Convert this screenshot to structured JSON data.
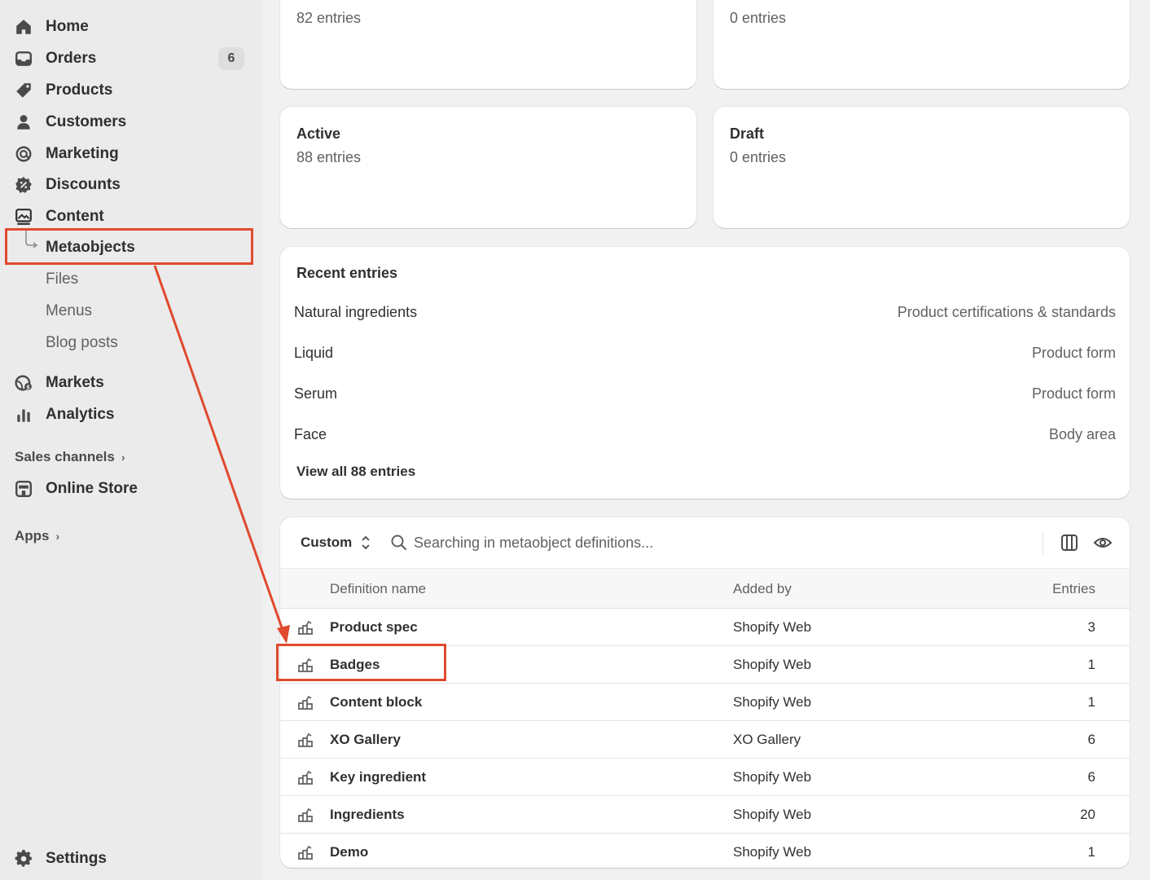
{
  "sidebar": {
    "items": [
      {
        "label": "Home",
        "icon": "home-icon"
      },
      {
        "label": "Orders",
        "icon": "inbox-icon",
        "badge": "6"
      },
      {
        "label": "Products",
        "icon": "tag-icon"
      },
      {
        "label": "Customers",
        "icon": "person-icon"
      },
      {
        "label": "Marketing",
        "icon": "target-icon"
      },
      {
        "label": "Discounts",
        "icon": "discount-icon"
      },
      {
        "label": "Content",
        "icon": "image-icon"
      }
    ],
    "content_sub": [
      "Metaobjects",
      "Files",
      "Menus",
      "Blog posts"
    ],
    "items2": [
      {
        "label": "Markets",
        "icon": "globe-icon"
      },
      {
        "label": "Analytics",
        "icon": "bar-chart-icon"
      }
    ],
    "sales_channels": "Sales channels",
    "online_store": "Online Store",
    "apps": "Apps",
    "settings": "Settings"
  },
  "cards": {
    "top_left_sub": "82 entries",
    "top_right_sub": "0 entries",
    "active": {
      "title": "Active",
      "sub": "88 entries"
    },
    "draft": {
      "title": "Draft",
      "sub": "0 entries"
    }
  },
  "recent": {
    "title": "Recent entries",
    "rows": [
      {
        "name": "Natural ingredients",
        "type": "Product certifications & standards"
      },
      {
        "name": "Liquid",
        "type": "Product form"
      },
      {
        "name": "Serum",
        "type": "Product form"
      },
      {
        "name": "Face",
        "type": "Body area"
      }
    ],
    "view_all": "View all 88 entries"
  },
  "table": {
    "filter": "Custom",
    "search_placeholder": "Searching in metaobject definitions...",
    "headers": {
      "name": "Definition name",
      "added_by": "Added by",
      "entries": "Entries"
    },
    "rows": [
      {
        "name": "Product spec",
        "added_by": "Shopify Web",
        "entries": "3"
      },
      {
        "name": "Badges",
        "added_by": "Shopify Web",
        "entries": "1"
      },
      {
        "name": "Content block",
        "added_by": "Shopify Web",
        "entries": "1"
      },
      {
        "name": "XO Gallery",
        "added_by": "XO Gallery",
        "entries": "6"
      },
      {
        "name": "Key ingredient",
        "added_by": "Shopify Web",
        "entries": "6"
      },
      {
        "name": "Ingredients",
        "added_by": "Shopify Web",
        "entries": "20"
      },
      {
        "name": "Demo",
        "added_by": "Shopify Web",
        "entries": "1"
      }
    ]
  },
  "colors": {
    "annotation": "#e04a2e",
    "sidebar_bg": "#ebebeb",
    "page_bg": "#f1f1f1"
  }
}
